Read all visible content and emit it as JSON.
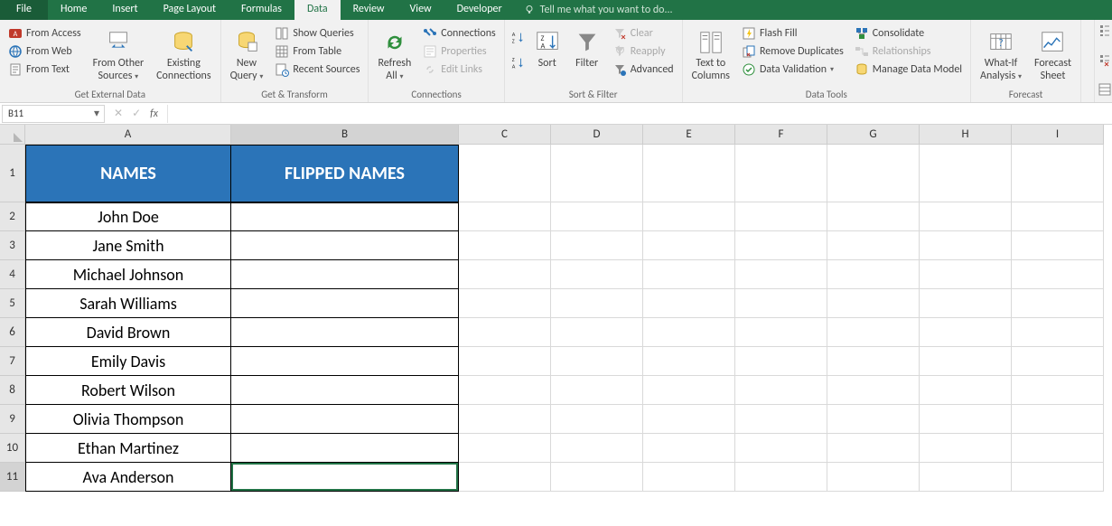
{
  "tabs": {
    "file": "File",
    "home": "Home",
    "insert": "Insert",
    "page_layout": "Page Layout",
    "formulas": "Formulas",
    "data": "Data",
    "review": "Review",
    "view": "View",
    "developer": "Developer",
    "tell_me": "Tell me what you want to do..."
  },
  "ribbon": {
    "ext": {
      "from_access": "From Access",
      "from_web": "From Web",
      "from_text": "From Text",
      "from_other": "From Other\nSources",
      "existing": "Existing\nConnections",
      "group": "Get External Data"
    },
    "gt": {
      "new_query": "New\nQuery",
      "show_queries": "Show Queries",
      "from_table": "From Table",
      "recent_sources": "Recent Sources",
      "group": "Get & Transform"
    },
    "conn": {
      "refresh_all": "Refresh\nAll",
      "connections": "Connections",
      "properties": "Properties",
      "edit_links": "Edit Links",
      "group": "Connections"
    },
    "sortfilter": {
      "sort": "Sort",
      "filter": "Filter",
      "clear": "Clear",
      "reapply": "Reapply",
      "advanced": "Advanced",
      "group": "Sort & Filter"
    },
    "datatools": {
      "text_to_columns": "Text to\nColumns",
      "flash_fill": "Flash Fill",
      "remove_duplicates": "Remove Duplicates",
      "data_validation": "Data Validation",
      "consolidate": "Consolidate",
      "relationships": "Relationships",
      "manage_model": "Manage Data Model",
      "group": "Data Tools"
    },
    "forecast": {
      "what_if": "What-If\nAnalysis",
      "forecast_sheet": "Forecast\nSheet",
      "group": "Forecast"
    }
  },
  "formula_bar": {
    "name_box": "B11",
    "formula": ""
  },
  "columns": [
    "A",
    "B",
    "C",
    "D",
    "E",
    "F",
    "G",
    "H",
    "I"
  ],
  "col_widths": {
    "A": 228,
    "B": 252,
    "other": 102
  },
  "rows": [
    "1",
    "2",
    "3",
    "4",
    "5",
    "6",
    "7",
    "8",
    "9",
    "10",
    "11"
  ],
  "selection": {
    "cell": "B11",
    "row": "11",
    "col": "B"
  },
  "table": {
    "header_a": "NAMES",
    "header_b": "FLIPPED NAMES",
    "names": [
      "John Doe",
      "Jane Smith",
      "Michael Johnson",
      "Sarah Williams",
      "David Brown",
      "Emily Davis",
      "Robert Wilson",
      "Olivia Thompson",
      "Ethan Martinez",
      "Ava Anderson"
    ]
  }
}
